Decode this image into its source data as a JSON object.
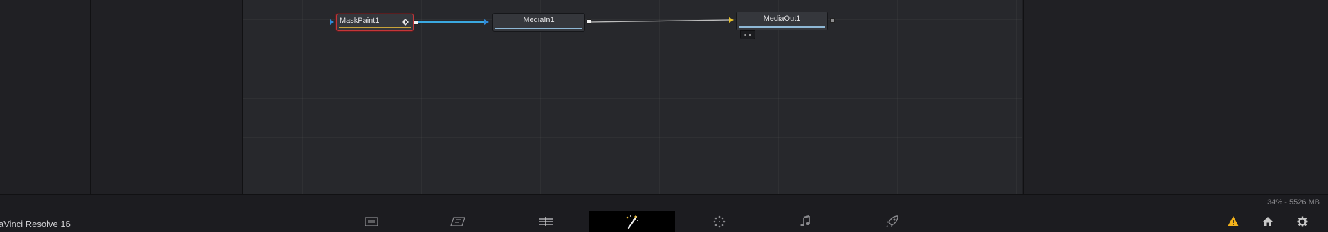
{
  "app": {
    "title": "aVinci Resolve 16",
    "memory_readout": "34% - 5526 MB"
  },
  "node_editor": {
    "nodes": [
      {
        "id": "maskpaint",
        "label": "MaskPaint1",
        "selected": true,
        "stripe_color": "#c9a43a"
      },
      {
        "id": "mediain",
        "label": "MediaIn1",
        "selected": false,
        "stripe_color": "#8fb8d6"
      },
      {
        "id": "mediaout",
        "label": "MediaOut1",
        "selected": false,
        "stripe_color": "#8fb8d6"
      }
    ],
    "connections": [
      {
        "from": "maskpaint",
        "to": "mediain",
        "color": "#3aa8e0"
      },
      {
        "from": "mediain",
        "to": "mediaout",
        "color": "#bdbdbd"
      }
    ]
  },
  "page_tabs": [
    {
      "name": "media",
      "icon": "media-page-icon",
      "active": false
    },
    {
      "name": "cut",
      "icon": "cut-page-icon",
      "active": false
    },
    {
      "name": "edit",
      "icon": "edit-page-icon",
      "active": false
    },
    {
      "name": "fusion",
      "icon": "fusion-page-icon",
      "active": true
    },
    {
      "name": "color",
      "icon": "color-page-icon",
      "active": false
    },
    {
      "name": "fairlight",
      "icon": "fairlight-page-icon",
      "active": false
    },
    {
      "name": "deliver",
      "icon": "deliver-page-icon",
      "active": false
    }
  ],
  "right_icons": [
    "warning-icon",
    "home-icon",
    "settings-icon"
  ],
  "colors": {
    "accent_warning": "#f2b21b",
    "selection": "#c4363a",
    "input_triangle_blue": "#2f8ad8",
    "input_triangle_yellow": "#e8c22a"
  }
}
